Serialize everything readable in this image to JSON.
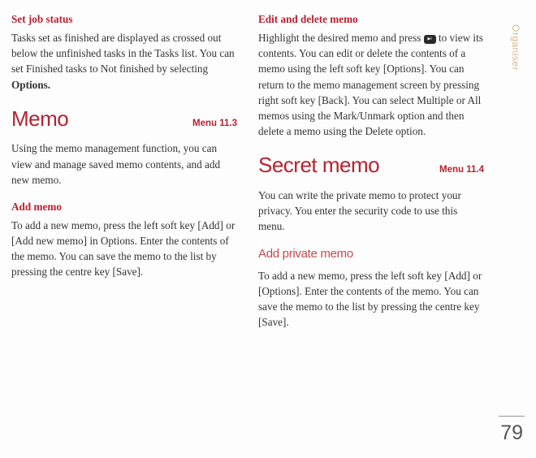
{
  "left": {
    "setJobStatus": {
      "heading": "Set job status",
      "body_a": "Tasks set as finished are displayed as crossed out below the unfinished tasks in the Tasks list. You can set Finished tasks to Not finished by selecting ",
      "body_bold": "Options."
    },
    "memo": {
      "title": "Memo",
      "menu": "Menu 11.3",
      "intro": "Using the memo management function, you can view and manage saved memo contents, and add new memo."
    },
    "addMemo": {
      "heading": "Add memo",
      "body": "To add a new memo, press the left soft key [Add] or [Add new memo] in Options. Enter the contents of the memo. You can save the memo to the list by pressing the centre key [Save]."
    }
  },
  "right": {
    "editDelete": {
      "heading": "Edit and delete memo",
      "body_a": "Highlight the desired memo and press ",
      "body_b": " to view its contents. You can edit or delete the contents of a memo using the left soft key [Options]. You can return to the memo management screen by pressing right soft key [Back]. You can select Multiple or All memos using the Mark/Unmark option and then delete a memo using the Delete option."
    },
    "secret": {
      "title": "Secret memo",
      "menu": "Menu 11.4",
      "intro": "You can write the private memo to protect your privacy. You enter the security code to use this menu."
    },
    "addPrivate": {
      "heading": "Add private memo",
      "body": "To add a new memo, press the left soft key [Add] or [Options]. Enter the contents of the memo. You can save the memo to the list by pressing the centre key [Save]."
    }
  },
  "sideTab": "Organiser",
  "pageNumber": "79",
  "icon": {
    "glyph": "▶ǁ"
  }
}
